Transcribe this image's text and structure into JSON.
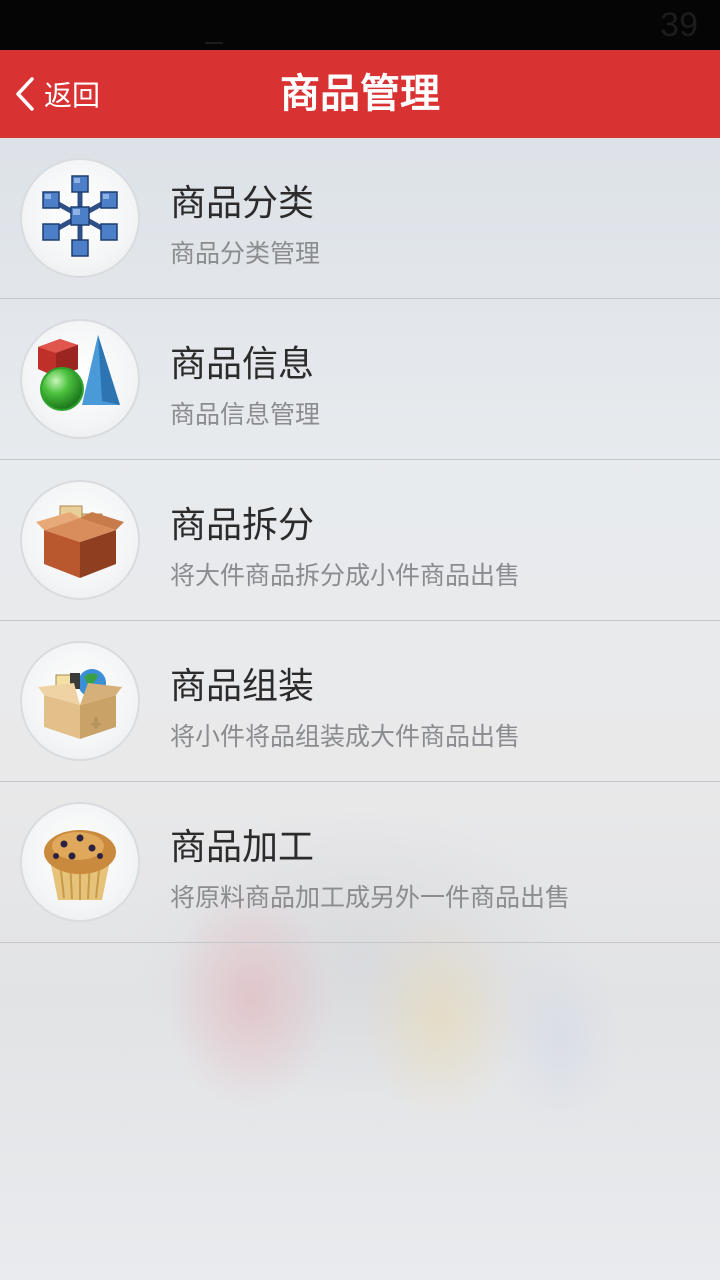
{
  "status_bar": {
    "clock": "39"
  },
  "header": {
    "back_label": "返回",
    "title": "商品管理"
  },
  "menu": [
    {
      "title": "商品分类",
      "subtitle": "商品分类管理",
      "icon": "network-cubes-icon"
    },
    {
      "title": "商品信息",
      "subtitle": "商品信息管理",
      "icon": "shapes-icon"
    },
    {
      "title": "商品拆分",
      "subtitle": "将大件商品拆分成小件商品出售",
      "icon": "open-box-icon"
    },
    {
      "title": "商品组装",
      "subtitle": "将小件将品组装成大件商品出售",
      "icon": "packed-box-icon"
    },
    {
      "title": "商品加工",
      "subtitle": "将原料商品加工成另外一件商品出售",
      "icon": "muffin-icon"
    }
  ],
  "colors": {
    "header": "#d83232",
    "status_bar": "#050505",
    "title_text": "#2b2b2b",
    "subtitle_text": "#8a8c8f"
  }
}
